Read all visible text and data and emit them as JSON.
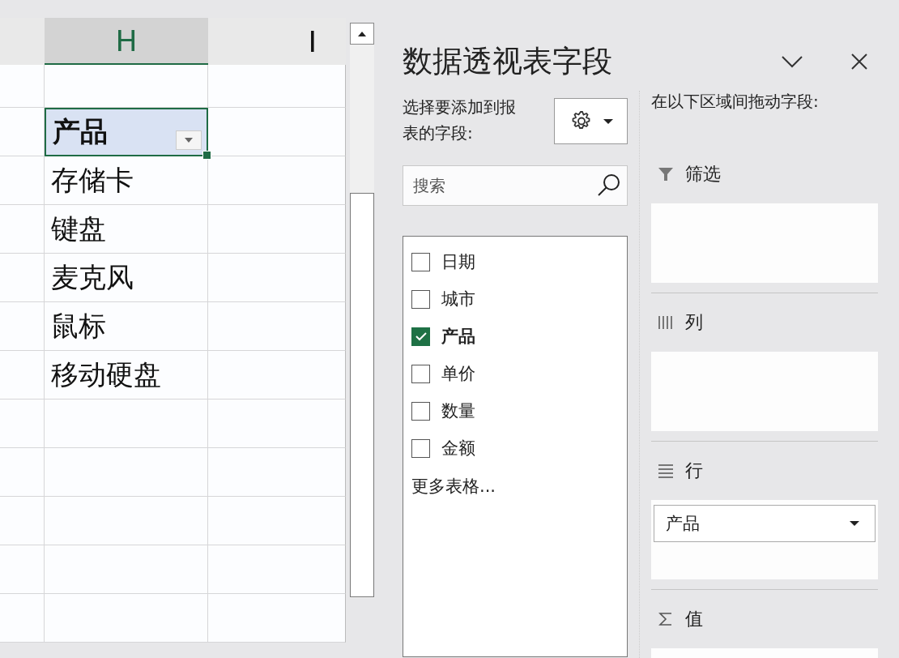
{
  "sheet": {
    "columns": [
      {
        "label": "H",
        "selected": true
      },
      {
        "label": "I",
        "selected": false
      }
    ],
    "rows": [
      {
        "kind": "empty",
        "selected": false
      },
      {
        "kind": "header",
        "value": "产品",
        "selected": true
      },
      {
        "kind": "item",
        "value": "存储卡",
        "selected": false
      },
      {
        "kind": "item",
        "value": "键盘",
        "selected": false
      },
      {
        "kind": "item",
        "value": "麦克风",
        "selected": false
      },
      {
        "kind": "item",
        "value": "鼠标",
        "selected": false
      },
      {
        "kind": "item",
        "value": "移动硬盘",
        "selected": false
      },
      {
        "kind": "empty",
        "selected": false
      },
      {
        "kind": "empty",
        "selected": false
      },
      {
        "kind": "empty",
        "selected": false
      },
      {
        "kind": "empty",
        "selected": false
      },
      {
        "kind": "empty",
        "selected": false
      }
    ]
  },
  "pane": {
    "title": "数据透视表字段",
    "choose_label": "选择要添加到报表的字段:",
    "search": {
      "placeholder": "搜索"
    },
    "fields": [
      {
        "label": "日期",
        "checked": false
      },
      {
        "label": "城市",
        "checked": false
      },
      {
        "label": "产品",
        "checked": true
      },
      {
        "label": "单价",
        "checked": false
      },
      {
        "label": "数量",
        "checked": false
      },
      {
        "label": "金额",
        "checked": false
      }
    ],
    "more_tables": "更多表格...",
    "areas_label": "在以下区域间拖动字段:",
    "areas": [
      {
        "kind": "filter",
        "label": "筛选"
      },
      {
        "kind": "columns",
        "label": "列"
      },
      {
        "kind": "rows",
        "label": "行",
        "items": [
          "产品"
        ]
      },
      {
        "kind": "values",
        "label": "值"
      }
    ]
  }
}
